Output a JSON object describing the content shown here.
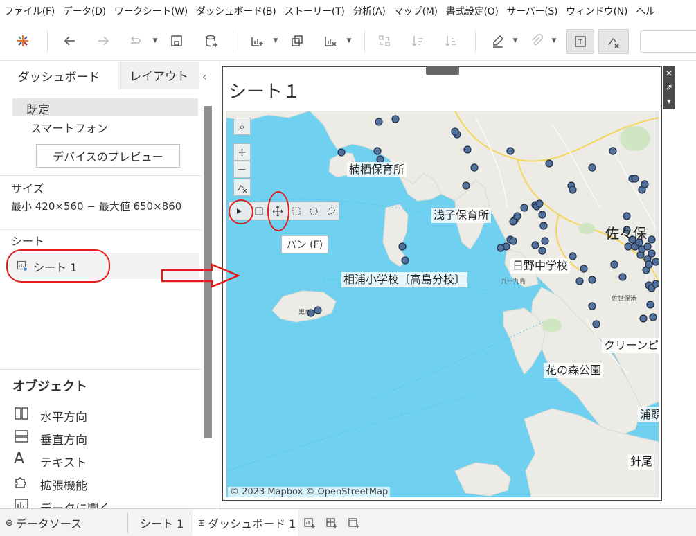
{
  "menu": [
    "ファイル(F)",
    "データ(D)",
    "ワークシート(W)",
    "ダッシュボード(B)",
    "ストーリー(T)",
    "分析(A)",
    "マップ(M)",
    "書式設定(O)",
    "サーバー(S)",
    "ウィンドウ(N)",
    "ヘル"
  ],
  "left_panel": {
    "tabs": [
      "ダッシュボード",
      "レイアウト"
    ],
    "collapse_glyph": "‹",
    "device": {
      "default": "既定",
      "phone": "スマートフォン",
      "preview_button": "デバイスのプレビュー"
    },
    "size": {
      "label": "サイズ",
      "value": "最小 420×560 − 最大値 650×860"
    },
    "sheets": {
      "label": "シート",
      "items": [
        "シート 1"
      ]
    },
    "objects": {
      "label": "オブジェクト",
      "items": [
        "水平方向",
        "垂直方向",
        "テキスト",
        "拡張機能",
        "データに聞く"
      ]
    }
  },
  "dashboard": {
    "sheet_title": "シート１",
    "side_buttons": [
      "✕",
      "⇗",
      "▾"
    ],
    "map": {
      "labels": [
        "楠栖保育所",
        "浅子保育所",
        "相浦小学校〔高島分校〕",
        "日野中学校",
        "クリーンピュ",
        "花の森公園",
        "浦頭",
        "針尾",
        "佐々保"
      ],
      "small_labels": [
        "九十九島",
        "佐世保港",
        "黒島"
      ],
      "copyright": "© 2023 Mapbox © OpenStreetMap",
      "tooltip": "パン (F)",
      "controls": {
        "search": "⌕",
        "zoom_in": "+",
        "zoom_out": "−"
      }
    }
  },
  "bottom_tabs": {
    "datasource": "データソース",
    "sheet": "シート 1",
    "dashboard": "ダッシュボード 1"
  },
  "colors": {
    "water": "#6fd0ef",
    "land": "#ecebe6",
    "point_fill": "#52719c",
    "point_stroke": "#1e2e46",
    "annotation_red": "#e31b1b"
  }
}
